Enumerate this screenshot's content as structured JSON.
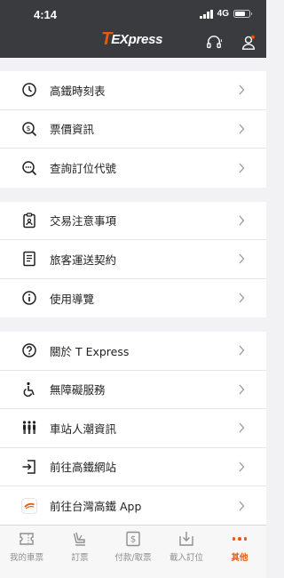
{
  "status_bar": {
    "time": "4:14",
    "network": "4G",
    "battery_level": 0.7
  },
  "header": {
    "logo_t": "T",
    "logo_rest": "EXpress",
    "brand_color": "#e8590c",
    "bg_color": "#3a3b3f"
  },
  "menu_groups": [
    [
      {
        "label": "高鐵時刻表",
        "icon": "clock-icon"
      },
      {
        "label": "票價資訊",
        "icon": "fare-icon"
      },
      {
        "label": "查詢訂位代號",
        "icon": "search-booking-icon"
      }
    ],
    [
      {
        "label": "交易注意事項",
        "icon": "clipboard-icon"
      },
      {
        "label": "旅客運送契約",
        "icon": "contract-icon"
      },
      {
        "label": "使用導覽",
        "icon": "info-icon"
      }
    ],
    [
      {
        "label": "關於 T Express",
        "icon": "question-icon"
      },
      {
        "label": "無障礙服務",
        "icon": "accessibility-icon"
      },
      {
        "label": "車站人潮資訊",
        "icon": "crowd-icon"
      },
      {
        "label": "前往高鐵網站",
        "icon": "external-link-icon"
      },
      {
        "label": "前往台灣高鐵 App",
        "icon": "thsr-app-icon"
      }
    ]
  ],
  "tabbar": {
    "tabs": [
      {
        "label": "我的車票",
        "icon": "ticket-icon"
      },
      {
        "label": "訂票",
        "icon": "seat-icon"
      },
      {
        "label": "付款/取票",
        "icon": "payment-icon"
      },
      {
        "label": "載入訂位",
        "icon": "load-booking-icon"
      },
      {
        "label": "其他",
        "icon": "more-icon"
      }
    ],
    "active_index": 4
  }
}
